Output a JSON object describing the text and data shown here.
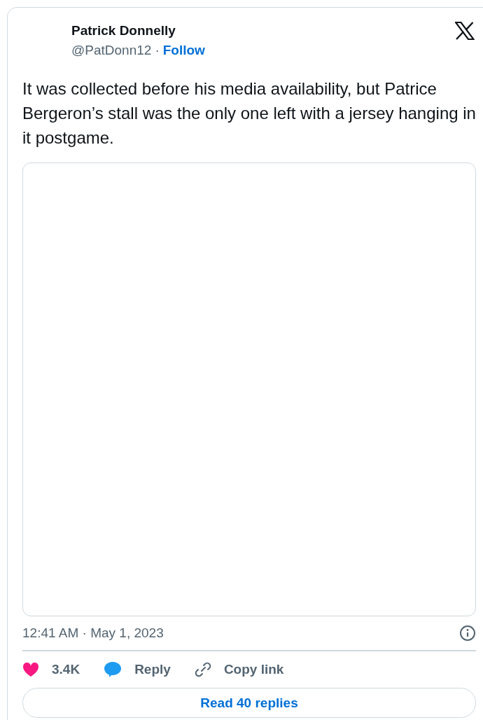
{
  "author": {
    "name": "Patrick Donnelly",
    "handle": "@PatDonn12",
    "separator": "·",
    "follow": "Follow"
  },
  "text": "It was collected before his media availability, but Patrice Bergeron’s stall was the only one left with a jersey hanging in it postgame.",
  "media": {
    "kind": "blank"
  },
  "timestamp": "12:41 AM · May 1, 2023",
  "actions": [
    {
      "kind": "like",
      "label": "3.4K"
    },
    {
      "kind": "reply",
      "label": "Reply"
    },
    {
      "kind": "copy",
      "label": "Copy link"
    }
  ],
  "read_replies": "Read 40 replies"
}
